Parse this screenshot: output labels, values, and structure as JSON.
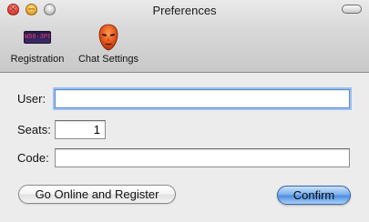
{
  "window": {
    "title": "Preferences",
    "controls": {
      "close": "×",
      "minimize": "−",
      "zoom": ""
    }
  },
  "toolbar": {
    "items": [
      {
        "label": "Registration",
        "icon": "license-plate-icon",
        "plate_text": "W58·3P6"
      },
      {
        "label": "Chat Settings",
        "icon": "mask-icon"
      }
    ]
  },
  "form": {
    "user": {
      "label": "User:",
      "value": "",
      "placeholder": ""
    },
    "seats": {
      "label": "Seats:",
      "value": "1"
    },
    "code": {
      "label": "Code:",
      "value": "",
      "placeholder": ""
    }
  },
  "buttons": {
    "register": "Go Online and Register",
    "confirm": "Confirm"
  },
  "colors": {
    "accent": "#4f8fe0",
    "focus_ring": "#9cbfee",
    "window_bg": "#ececec"
  }
}
